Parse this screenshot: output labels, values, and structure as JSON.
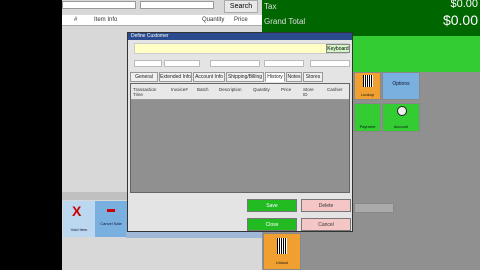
{
  "pos": {
    "search_label": "Search",
    "columns": [
      "#",
      "Item Info",
      "Quantity",
      "Price"
    ]
  },
  "totals": {
    "tax_label": "Tax",
    "tax_value": "$0.00",
    "grand_label": "Grand Total",
    "grand_value": "$0.00"
  },
  "dialog": {
    "title": "Define Customer",
    "keyboard_label": "Keyboard",
    "tabs": [
      "General Info",
      "Extended Info",
      "Account Info",
      "Shipping/Billing",
      "History",
      "Notes",
      "Stores"
    ],
    "active_tab_index": 4,
    "grid_columns": [
      "Transaction Time",
      "Invoice#",
      "Batch",
      "Description",
      "Quantity",
      "Price",
      "Store ID",
      "Cashier"
    ]
  },
  "left_actions": {
    "void_label": "Void Item",
    "cancel_label": "Cancel Sale",
    "previous_label": "Previous",
    "next_label": "Next"
  },
  "dialog_buttons": {
    "save_label": "Save",
    "delete_label": "Delete",
    "close_label": "Close",
    "cancel_label": "Cancel"
  },
  "right_tiles": {
    "lookup_label": "Lookup",
    "options_label": "Options",
    "payment_label": "Payment",
    "account_label": "Account",
    "unlock_label": "Unlock"
  },
  "colors": {
    "accent_green": "#006600",
    "tile_green": "#33cc33",
    "tile_blue": "#7ab0e0"
  }
}
